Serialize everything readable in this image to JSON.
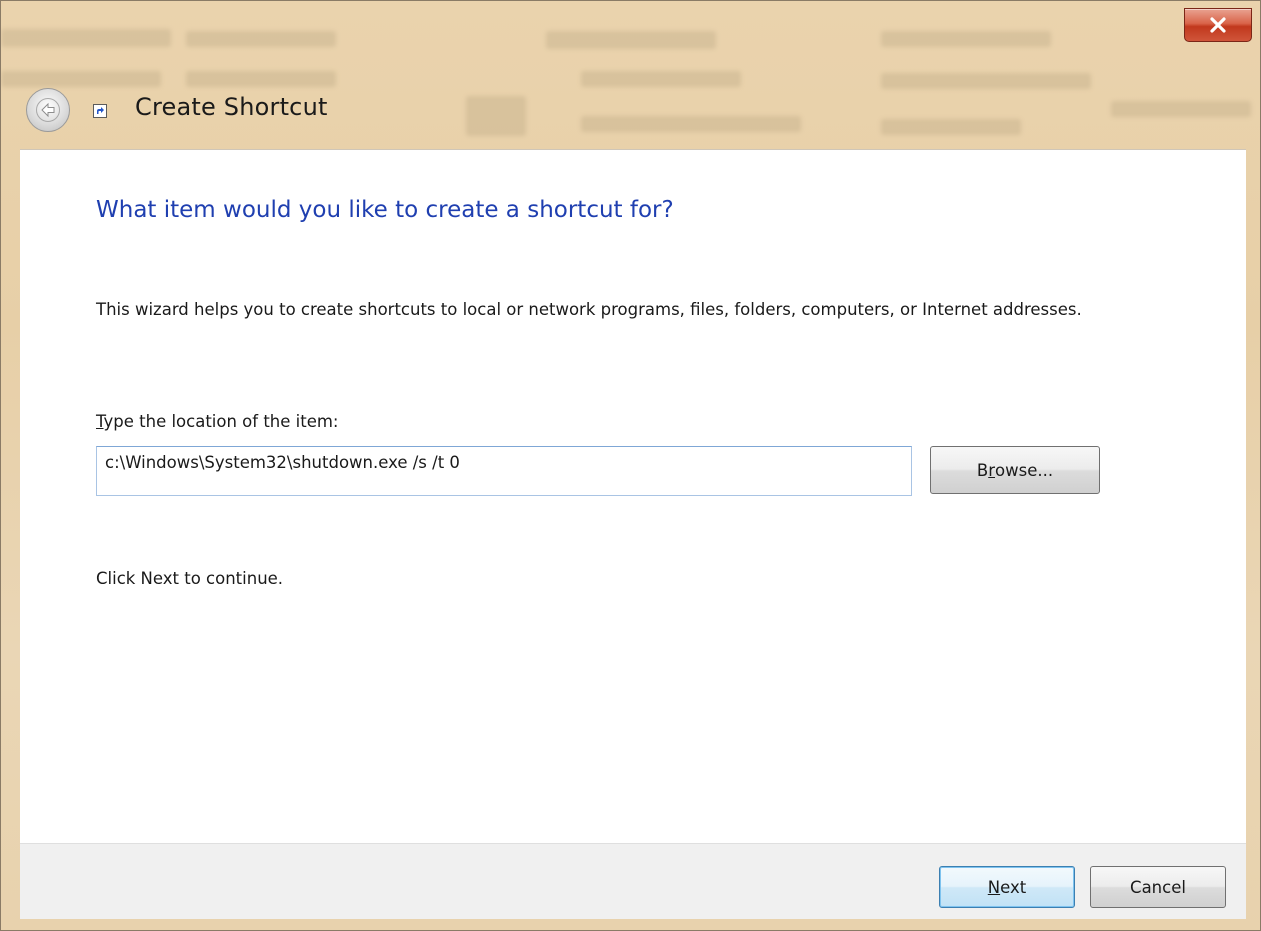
{
  "window": {
    "title": "Create Shortcut",
    "close_label": "×"
  },
  "icons": {
    "back": "back-arrow-icon",
    "shortcut": "shortcut-icon",
    "close": "close-icon"
  },
  "page": {
    "heading": "What item would you like to create a shortcut for?",
    "description": "This wizard helps you to create shortcuts to local or network programs, files, folders, computers, or Internet addresses.",
    "location_label_mnemonic": "T",
    "location_label_rest": "ype the location of the item:",
    "location_value": "c:\\Windows\\System32\\shutdown.exe /s /t 0",
    "browse_pre": "B",
    "browse_mnemonic": "r",
    "browse_rest": "owse...",
    "continue_text": "Click Next to continue."
  },
  "footer": {
    "next_mnemonic": "N",
    "next_rest": "ext",
    "cancel_label": "Cancel"
  },
  "colors": {
    "heading": "#1f3fb0",
    "close_button": "#c1381d",
    "frame": "#e9d3b0"
  }
}
